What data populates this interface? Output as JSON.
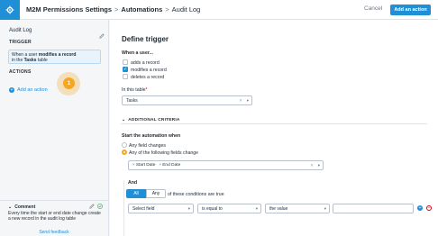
{
  "topbar": {
    "breadcrumb": [
      "M2M Permissions Settings",
      "Automations",
      "Audit Log"
    ],
    "cancel_label": "Cancel",
    "add_action_label": "Add an action"
  },
  "sidebar": {
    "title": "Audit Log",
    "trigger_heading": "TRIGGER",
    "trigger_card": {
      "prefix": "When a user",
      "bold_action": "modifies a record",
      "middle": "in the",
      "bold_table": "Tasks",
      "suffix": "table"
    },
    "actions_heading": "ACTIONS",
    "add_action_link": "Add an action",
    "beacon_number": "1",
    "comment": {
      "heading": "Comment",
      "text": "Every time the start or end date change create a new record in the audit log table"
    },
    "feedback_link": "Send feedback"
  },
  "main": {
    "title": "Define trigger",
    "when_user_label": "When a user...",
    "options": [
      {
        "label": "adds a record",
        "checked": false
      },
      {
        "label": "modifies a record",
        "checked": true
      },
      {
        "label": "deletes a record",
        "checked": false
      }
    ],
    "table_label": "In this table",
    "table_required_mark": "*",
    "table_value": "Tasks",
    "additional_criteria_label": "ADDITIONAL CRITERIA",
    "start_label": "Start the automation when",
    "radio_options": [
      {
        "label": "Any field changes",
        "selected": false
      },
      {
        "label": "Any of the following fields change",
        "selected": true
      }
    ],
    "field_chips": [
      "Start Date",
      "End Date"
    ],
    "and_label": "And",
    "toggle": {
      "all": "All",
      "any": "Any",
      "suffix": "of these conditions are true"
    },
    "condition": {
      "field_placeholder": "Select field",
      "operator": "is equal to",
      "value_source": "the value",
      "value_input": ""
    }
  },
  "colors": {
    "accent": "#1f8fd6",
    "beacon": "#f5a623",
    "required": "#d0021b"
  }
}
